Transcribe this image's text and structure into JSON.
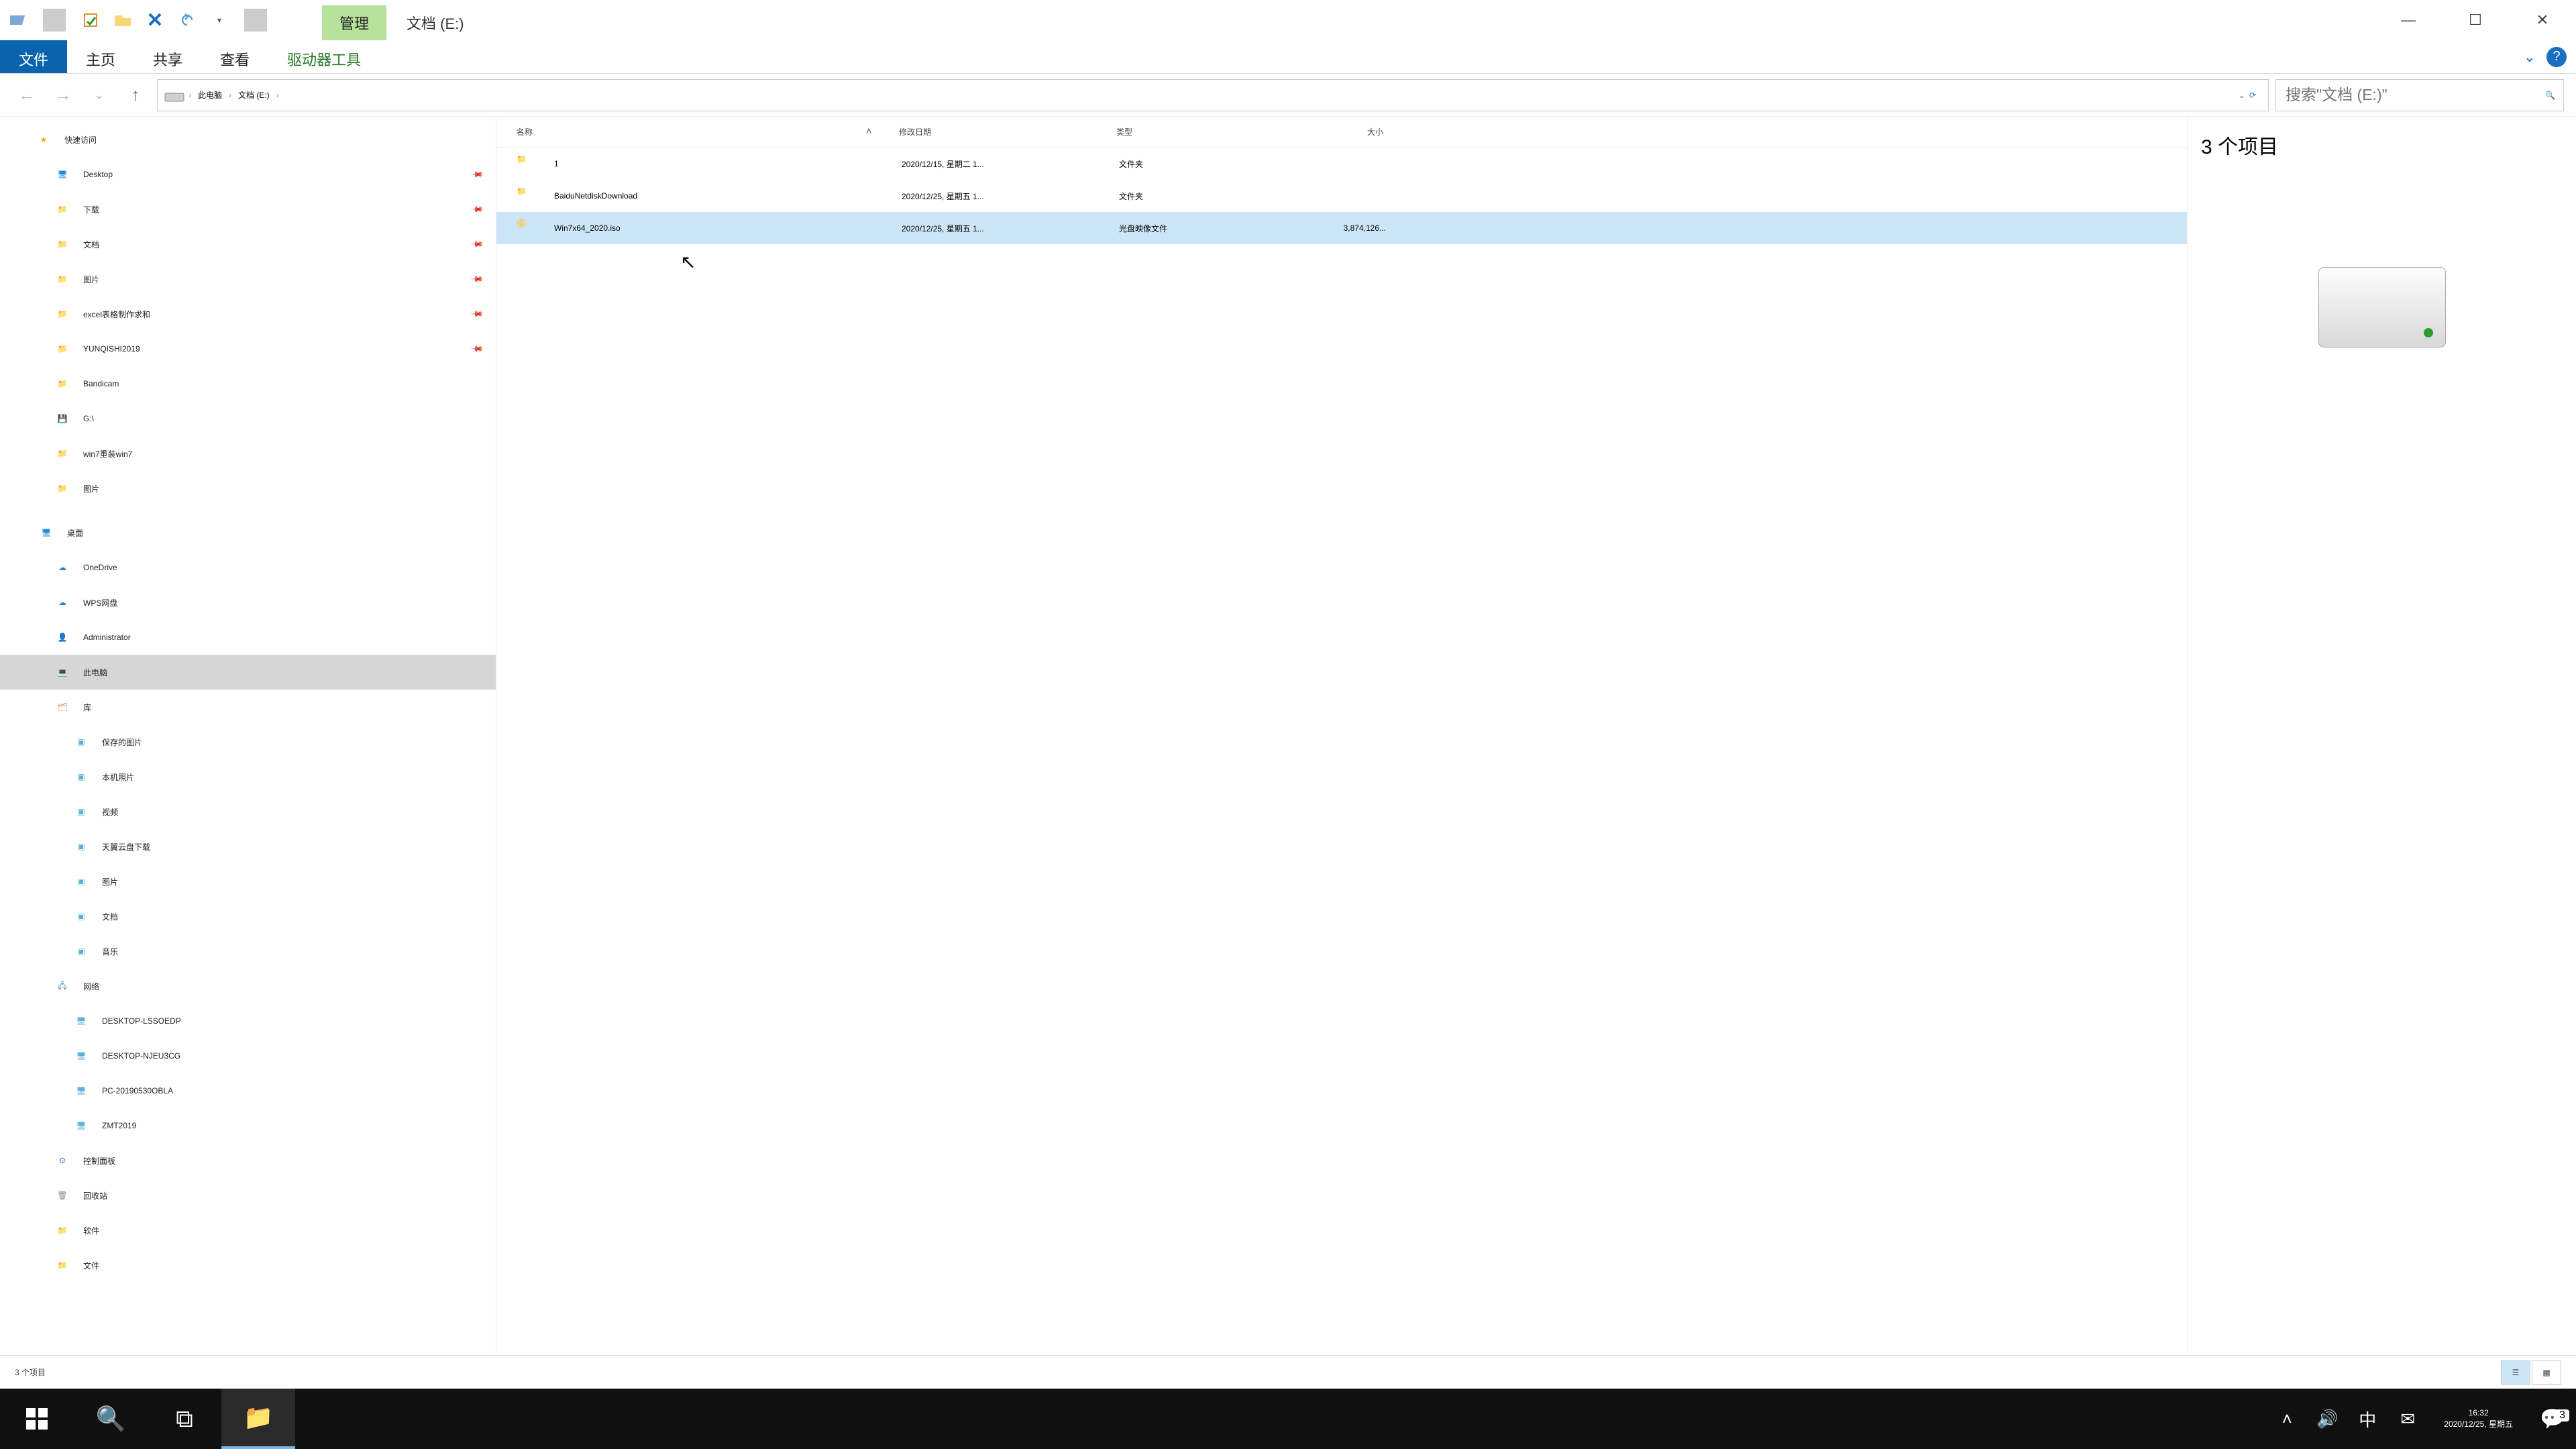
{
  "titlebar": {
    "contextual_tab": "管理",
    "title": "文档 (E:)"
  },
  "ribbon": {
    "file": "文件",
    "home": "主页",
    "share": "共享",
    "view": "查看",
    "drive_tools": "驱动器工具"
  },
  "breadcrumb": {
    "this_pc": "此电脑",
    "location": "文档 (E:)"
  },
  "search": {
    "placeholder": "搜索\"文档 (E:)\""
  },
  "nav": {
    "quick_access": "快速访问",
    "items_qa": [
      {
        "label": "Desktop",
        "icon": "desktop"
      },
      {
        "label": "下载",
        "icon": "folder"
      },
      {
        "label": "文档",
        "icon": "folder"
      },
      {
        "label": "图片",
        "icon": "folder"
      },
      {
        "label": "excel表格制作求和",
        "icon": "folder"
      },
      {
        "label": "YUNQISHI2019",
        "icon": "folder"
      },
      {
        "label": "Bandicam",
        "icon": "folder"
      },
      {
        "label": "G:\\",
        "icon": "drive"
      },
      {
        "label": "win7重装win7",
        "icon": "folder"
      },
      {
        "label": "图片",
        "icon": "folder"
      }
    ],
    "desktop_root": "桌面",
    "cloud": [
      {
        "label": "OneDrive",
        "icon": "onedrive"
      },
      {
        "label": "WPS网盘",
        "icon": "wps"
      }
    ],
    "user": "Administrator",
    "this_pc": "此电脑",
    "libraries": "库",
    "lib_items": [
      {
        "label": "保存的图片"
      },
      {
        "label": "本机照片"
      },
      {
        "label": "视频"
      },
      {
        "label": "天翼云盘下载"
      },
      {
        "label": "图片"
      },
      {
        "label": "文档"
      },
      {
        "label": "音乐"
      }
    ],
    "network": "网络",
    "net_items": [
      {
        "label": "DESKTOP-LSSOEDP"
      },
      {
        "label": "DESKTOP-NJEU3CG"
      },
      {
        "label": "PC-20190530OBLA"
      },
      {
        "label": "ZMT2019"
      }
    ],
    "control_panel": "控制面板",
    "recycle": "回收站",
    "software": "软件",
    "files": "文件"
  },
  "columns": {
    "name": "名称",
    "date": "修改日期",
    "type": "类型",
    "size": "大小"
  },
  "rows": [
    {
      "name": "1",
      "date": "2020/12/15, 星期二 1...",
      "type": "文件夹",
      "size": "",
      "icon": "folder",
      "sel": false
    },
    {
      "name": "BaiduNetdiskDownload",
      "date": "2020/12/25, 星期五 1...",
      "type": "文件夹",
      "size": "",
      "icon": "folder",
      "sel": false
    },
    {
      "name": "Win7x64_2020.iso",
      "date": "2020/12/25, 星期五 1...",
      "type": "光盘映像文件",
      "size": "3,874,126...",
      "icon": "iso",
      "sel": true
    }
  ],
  "preview": {
    "header": "3 个项目"
  },
  "status": {
    "left": "3 个项目"
  },
  "taskbar": {
    "time": "16:32",
    "date": "2020/12/25, 星期五",
    "ime": "中",
    "notif_count": "3"
  }
}
